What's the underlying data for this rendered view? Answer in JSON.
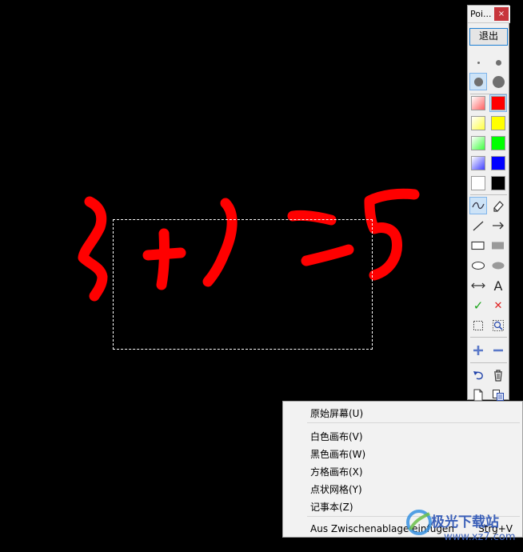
{
  "window": {
    "title": "Poi...",
    "close_glyph": "×"
  },
  "toolbar": {
    "exit_label": "退出",
    "text_tool_glyph": "A",
    "confirm_glyph": "✓",
    "cancel_glyph": "✕",
    "swatch_colors": [
      [
        "#ff7a7a",
        "#ff0000"
      ],
      [
        "#ffff80",
        "#ffff00"
      ],
      [
        "#80ff80",
        "#00ff00"
      ],
      [
        "#8080ff",
        "#0000ff"
      ],
      [
        "#ffffff",
        "#000000"
      ]
    ]
  },
  "menu": {
    "items": [
      {
        "label": "原始屏幕(U)",
        "shortcut": ""
      },
      {
        "label": "白色画布(V)",
        "shortcut": ""
      },
      {
        "label": "黑色画布(W)",
        "shortcut": ""
      },
      {
        "label": "方格画布(X)",
        "shortcut": ""
      },
      {
        "label": "点状网格(Y)",
        "shortcut": ""
      },
      {
        "label": "记事本(Z)",
        "shortcut": ""
      },
      {
        "label": "Aus Zwischenablage einfügen",
        "shortcut": "Strg+V"
      }
    ]
  },
  "watermark": {
    "title": "极光下载站",
    "url": "www.xz7.com"
  },
  "colors": {
    "ink": "#ff0000",
    "canvas": "#000000",
    "accent": "#1c7fd3"
  }
}
